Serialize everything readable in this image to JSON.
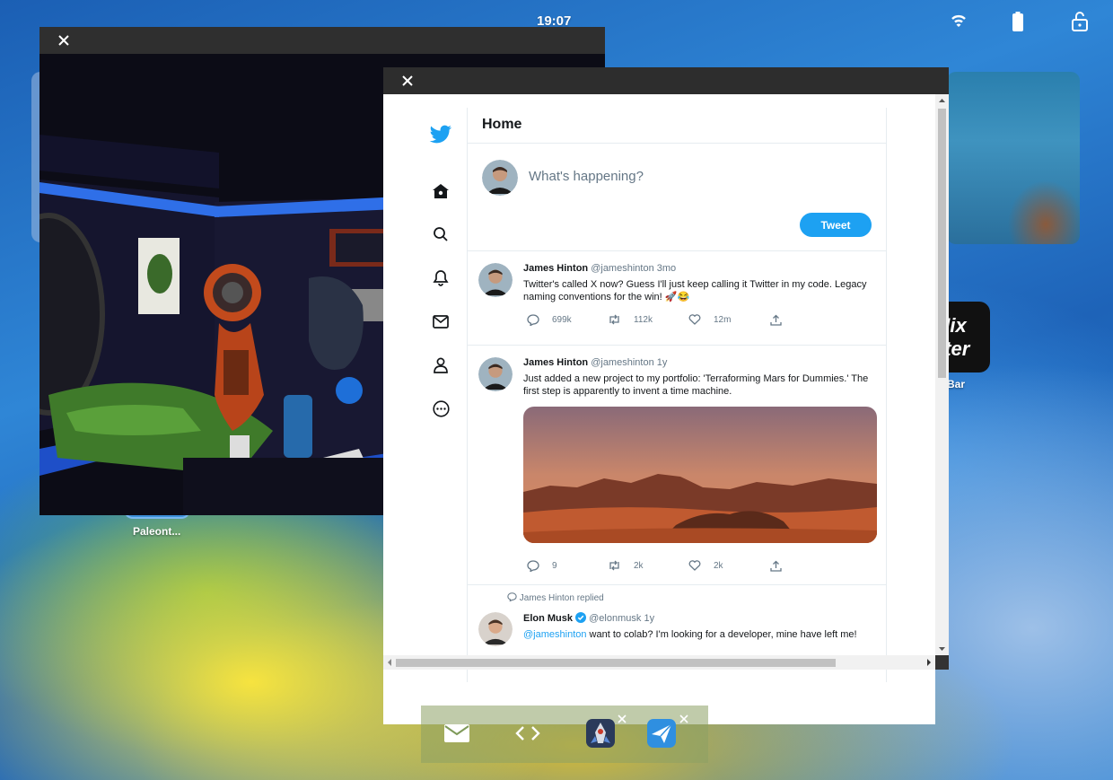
{
  "status_bar": {
    "time": "19:07",
    "icons": [
      "wifi-icon",
      "battery-icon",
      "lock-open-icon"
    ]
  },
  "desktop": {
    "apps": [
      {
        "label": "Paleont...",
        "icon": "paleontology-app-icon"
      },
      {
        "label": "Bar",
        "icon": "mix-master-app-icon",
        "icon_text": "Mix ster"
      }
    ]
  },
  "windows": {
    "scene_window": {
      "close_icon": "close-icon"
    },
    "twitter_window": {
      "close_icon": "close-icon"
    }
  },
  "twitter": {
    "nav": [
      "twitter-bird-icon",
      "home-icon",
      "search-icon",
      "bell-icon",
      "mail-icon",
      "profile-icon",
      "more-icon"
    ],
    "header": "Home",
    "compose": {
      "placeholder": "What's happening?",
      "button": "Tweet"
    },
    "tweets": [
      {
        "name": "James Hinton",
        "handle": "@jameshinton",
        "time": "3mo",
        "text": "Twitter's called X now? Guess I'll just keep calling it Twitter in my code. Legacy naming conventions for the win! 🚀😂",
        "replies": "699k",
        "retweets": "112k",
        "likes": "12m"
      },
      {
        "name": "James Hinton",
        "handle": "@jameshinton",
        "time": "1y",
        "text": "Just added a new project to my portfolio: 'Terraforming Mars for Dummies.' The first step is apparently to invent a time machine.",
        "replies": "9",
        "retweets": "2k",
        "likes": "2k"
      },
      {
        "context": "James Hinton replied",
        "name": "Elon Musk",
        "handle": "@elonmusk",
        "time": "1y",
        "mention": "@jameshinton",
        "text": " want to colab? I'm looking for a developer, mine have left me!"
      }
    ]
  },
  "dock": {
    "page_dots": 3,
    "active_dot": 0,
    "items": [
      "mail-icon",
      "code-icon",
      "rocket-app-icon",
      "paper-plane-app-icon"
    ]
  },
  "colors": {
    "twitter_blue": "#1da1f2",
    "titlebar": "#2d2d2d"
  }
}
